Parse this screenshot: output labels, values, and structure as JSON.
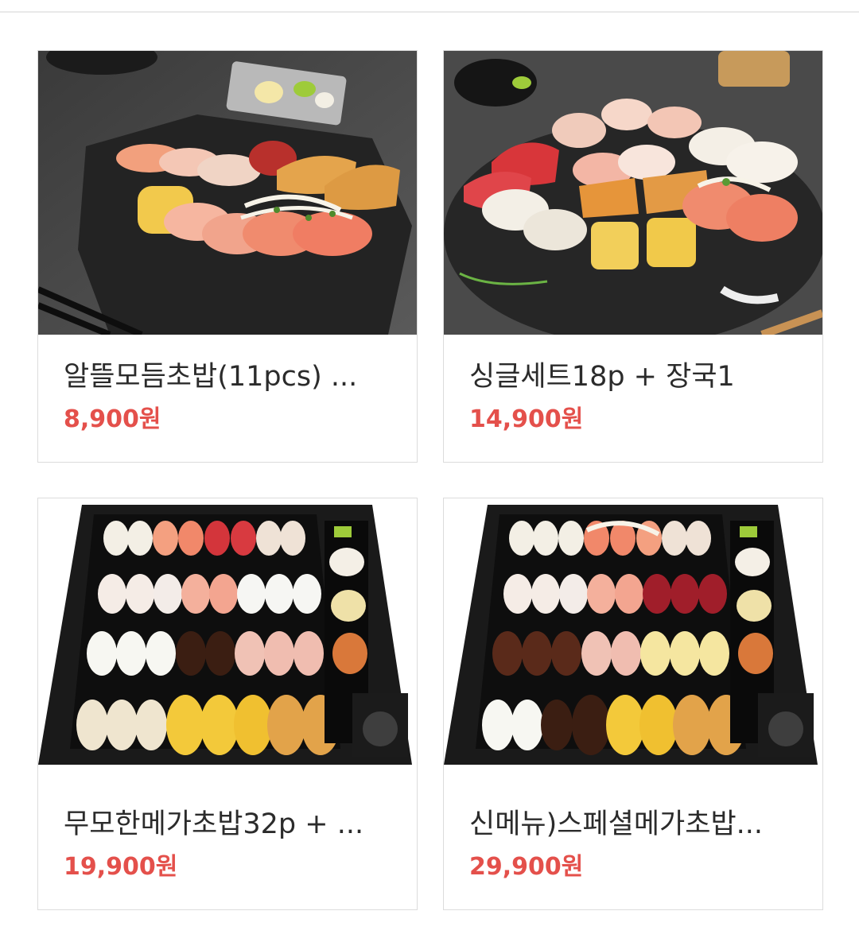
{
  "products": [
    {
      "title": "알뜰모듬초밥(11pcs) ...",
      "price": "8,900원",
      "image_desc": "sushi-on-stone-plate"
    },
    {
      "title": "싱글세트18p + 장국1",
      "price": "14,900원",
      "image_desc": "sushi-on-round-slate"
    },
    {
      "title": "무모한메가초밥32p + ...",
      "price": "19,900원",
      "image_desc": "sushi-tray-32p"
    },
    {
      "title": "신메뉴)스페셜메가초밥...",
      "price": "29,900원",
      "image_desc": "sushi-tray-special"
    }
  ],
  "colors": {
    "price": "#e4504b",
    "title": "#2b2b2b",
    "card_border": "#dcdcdc"
  }
}
